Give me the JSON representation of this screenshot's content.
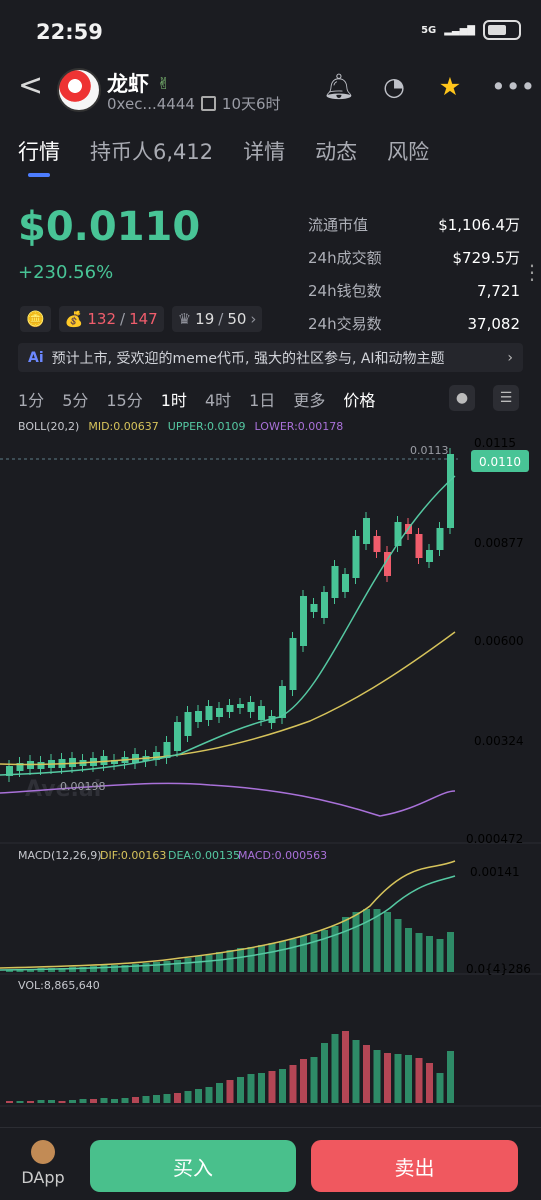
{
  "status": {
    "time": "22:59",
    "network": "5G",
    "battery": "45"
  },
  "header": {
    "back": "<",
    "token_name": "龙虾",
    "verify_icon": "hand-icon",
    "address": "0xec...4444",
    "age": "10天6时",
    "icons": [
      "bell-icon",
      "gauge-icon",
      "star-icon",
      "more-icon"
    ]
  },
  "tabs": [
    {
      "label": "行情"
    },
    {
      "label": "持币人6,412"
    },
    {
      "label": "详情"
    },
    {
      "label": "动态"
    },
    {
      "label": "风险"
    }
  ],
  "price": {
    "value": "$0.0110",
    "change": "+230.56%"
  },
  "stats": [
    {
      "label": "流通市值",
      "value": "$1,106.4万"
    },
    {
      "label": "24h成交额",
      "value": "$729.5万"
    },
    {
      "label": "24h钱包数",
      "value": "7,721"
    },
    {
      "label": "24h交易数",
      "value": "37,082"
    }
  ],
  "pills": {
    "value1": "132",
    "value2": "147",
    "value3": "19",
    "value4": "50"
  },
  "banner": {
    "ai": "Ai",
    "text": "预计上市, 受欢迎的meme代币, 强大的社区参与, AI和动物主题"
  },
  "intervals": [
    "1分",
    "5分",
    "15分",
    "1时",
    "4时",
    "1日",
    "更多",
    "价格"
  ],
  "selected_interval": "1时",
  "chart_data": {
    "type": "line",
    "series": [
      {
        "name": "BOLL(20,2)",
        "values": []
      },
      {
        "name": "MID",
        "values": [
          "0.00637"
        ]
      },
      {
        "name": "UPPER",
        "values": [
          "0.0109"
        ]
      },
      {
        "name": "LOWER",
        "values": [
          "0.00178"
        ]
      }
    ],
    "y_labels": [
      "0.0115",
      "0.00877",
      "0.00600",
      "0.00324",
      "0.000472"
    ],
    "labels": {
      "current": "0.0110",
      "high": "0.0113",
      "low": "0.00198",
      "watermark": "Ave.ai"
    },
    "macd": {
      "title": "MACD(12,26,9)",
      "dif": "DIF:0.00163",
      "dea": "DEA:0.00135",
      "macd": "MACD:0.000563",
      "top": "0.00141",
      "bottom": "0.0{4}286"
    },
    "vol": {
      "title": "VOL:8,865,640"
    }
  },
  "bottom": {
    "dapp": "DApp",
    "buy": "买入",
    "sell": "卖出"
  },
  "colors": {
    "up": "#48c496",
    "down": "#f05d6c",
    "mid": "#d6c35b",
    "upper": "#55c8a2",
    "lower": "#a971d9"
  }
}
